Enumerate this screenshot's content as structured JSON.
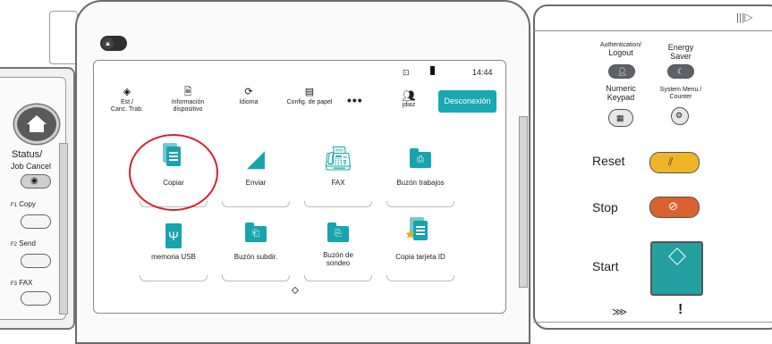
{
  "status_bar": {
    "time": "14:44"
  },
  "shortcuts": [
    {
      "label": "Est./\nCanc. Trab.",
      "icon": "job-status-icon"
    },
    {
      "label": "Información\ndispositivo",
      "icon": "device-info-icon"
    },
    {
      "label": "Idioma",
      "icon": "language-icon"
    },
    {
      "label": "Config. de papel",
      "icon": "paper-settings-icon"
    }
  ],
  "more_label": "•••",
  "user": {
    "name": "jdiaz",
    "icon": "user-group-icon"
  },
  "logout_button": "Desconexión",
  "apps": [
    {
      "label": "Copiar",
      "icon": "copy-icon"
    },
    {
      "label": "Enviar",
      "icon": "send-icon"
    },
    {
      "label": "FAX",
      "icon": "fax-icon"
    },
    {
      "label": "Buzón trabajos",
      "icon": "job-box-icon"
    },
    {
      "label": "memoria USB",
      "icon": "usb-icon"
    },
    {
      "label": "Buzón subdir.",
      "icon": "subaddress-box-icon"
    },
    {
      "label": "Buzón de\nsondeo",
      "icon": "polling-box-icon"
    },
    {
      "label": "Copia tarjeta ID",
      "icon": "id-card-copy-icon"
    }
  ],
  "left_panel": {
    "status_label": "Status/",
    "job_cancel_label": "Job Cancel",
    "f1": {
      "key": "F1",
      "label": "Copy"
    },
    "f2": {
      "key": "F2",
      "label": "Send"
    },
    "f3": {
      "key": "F3",
      "label": "FAX"
    }
  },
  "right_panel": {
    "auth_label": "Authentication/",
    "logout_label": "Logout",
    "energy_label_1": "Energy",
    "energy_label_2": "Saver",
    "numeric_label_1": "Numeric",
    "numeric_label_2": "Keypad",
    "system_menu_label_1": "System Menu /",
    "system_menu_label_2": "Counter",
    "reset_label": "Reset",
    "stop_label": "Stop",
    "start_label": "Start"
  },
  "colors": {
    "accent": "#17a4ae",
    "highlight_circle": "#d4232a",
    "reset_button": "#f0b429",
    "stop_button": "#d9622e",
    "start_button": "#24a0a0"
  }
}
